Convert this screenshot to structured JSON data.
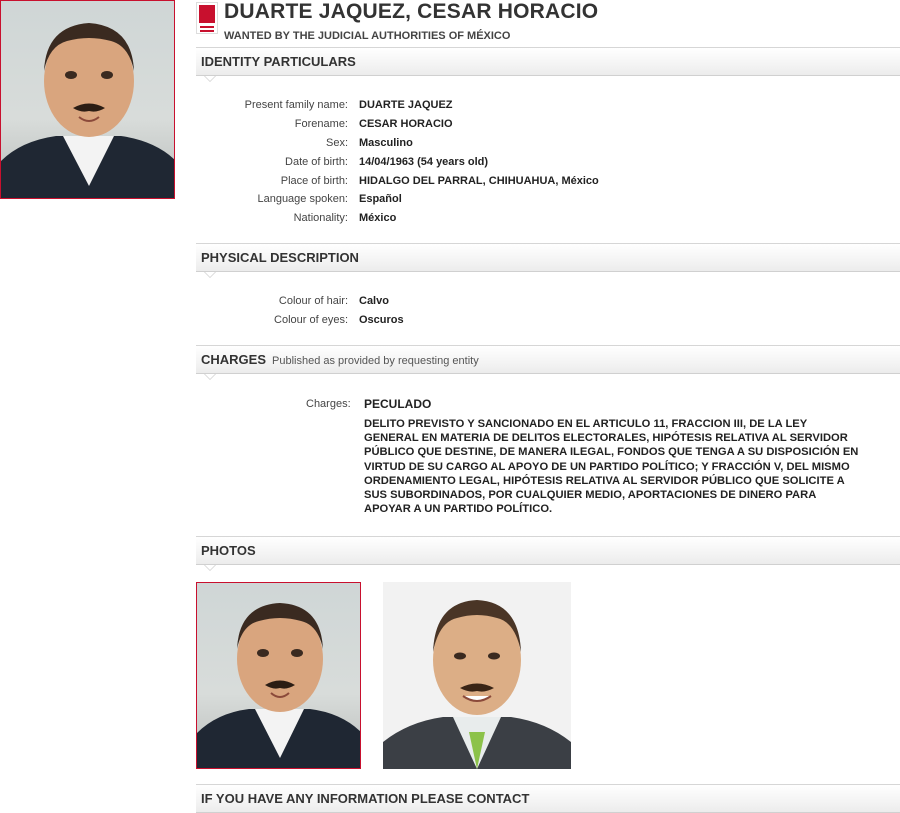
{
  "header": {
    "name": "DUARTE JAQUEZ, CESAR HORACIO",
    "wanted_by": "WANTED BY THE JUDICIAL AUTHORITIES OF MÉXICO"
  },
  "sections": {
    "identity": "IDENTITY PARTICULARS",
    "physical": "PHYSICAL DESCRIPTION",
    "charges": "CHARGES",
    "charges_sub": "Published as provided by requesting entity",
    "photos": "PHOTOS",
    "contact": "IF YOU HAVE ANY INFORMATION PLEASE CONTACT"
  },
  "identity": [
    {
      "label": "Present family name:",
      "value": "DUARTE JAQUEZ"
    },
    {
      "label": "Forename:",
      "value": "CESAR HORACIO"
    },
    {
      "label": "Sex:",
      "value": "Masculino"
    },
    {
      "label": "Date of birth:",
      "value": "14/04/1963 (54 years old)"
    },
    {
      "label": "Place of birth:",
      "value": "HIDALGO DEL PARRAL, CHIHUAHUA, México"
    },
    {
      "label": "Language spoken:",
      "value": "Español"
    },
    {
      "label": "Nationality:",
      "value": "México"
    }
  ],
  "physical": [
    {
      "label": "Colour of hair:",
      "value": "Calvo"
    },
    {
      "label": "Colour of eyes:",
      "value": "Oscuros"
    }
  ],
  "charges": {
    "label": "Charges:",
    "title": "PECULADO",
    "detail": "DELITO PREVISTO Y SANCIONADO EN EL ARTICULO 11, FRACCION III, DE LA LEY GENERAL EN MATERIA DE DELITOS ELECTORALES, HIPÓTESIS RELATIVA AL SERVIDOR PÚBLICO QUE DESTINE, DE MANERA ILEGAL, FONDOS QUE TENGA A SU DISPOSICIÓN EN VIRTUD DE SU CARGO AL APOYO DE UN PARTIDO POLÍTICO; Y FRACCIÓN V, DEL MISMO ORDENAMIENTO LEGAL, HIPÓTESIS RELATIVA AL SERVIDOR PÚBLICO QUE SOLICITE A SUS SUBORDINADOS, POR CUALQUIER MEDIO, APORTACIONES DE DINERO PARA APOYAR A UN PARTIDO POLÍTICO."
  },
  "colors": {
    "accent": "#c8102e",
    "bar": "#f2f2f2"
  },
  "icons": {
    "notice_badge": "red-notice-badge-icon"
  }
}
